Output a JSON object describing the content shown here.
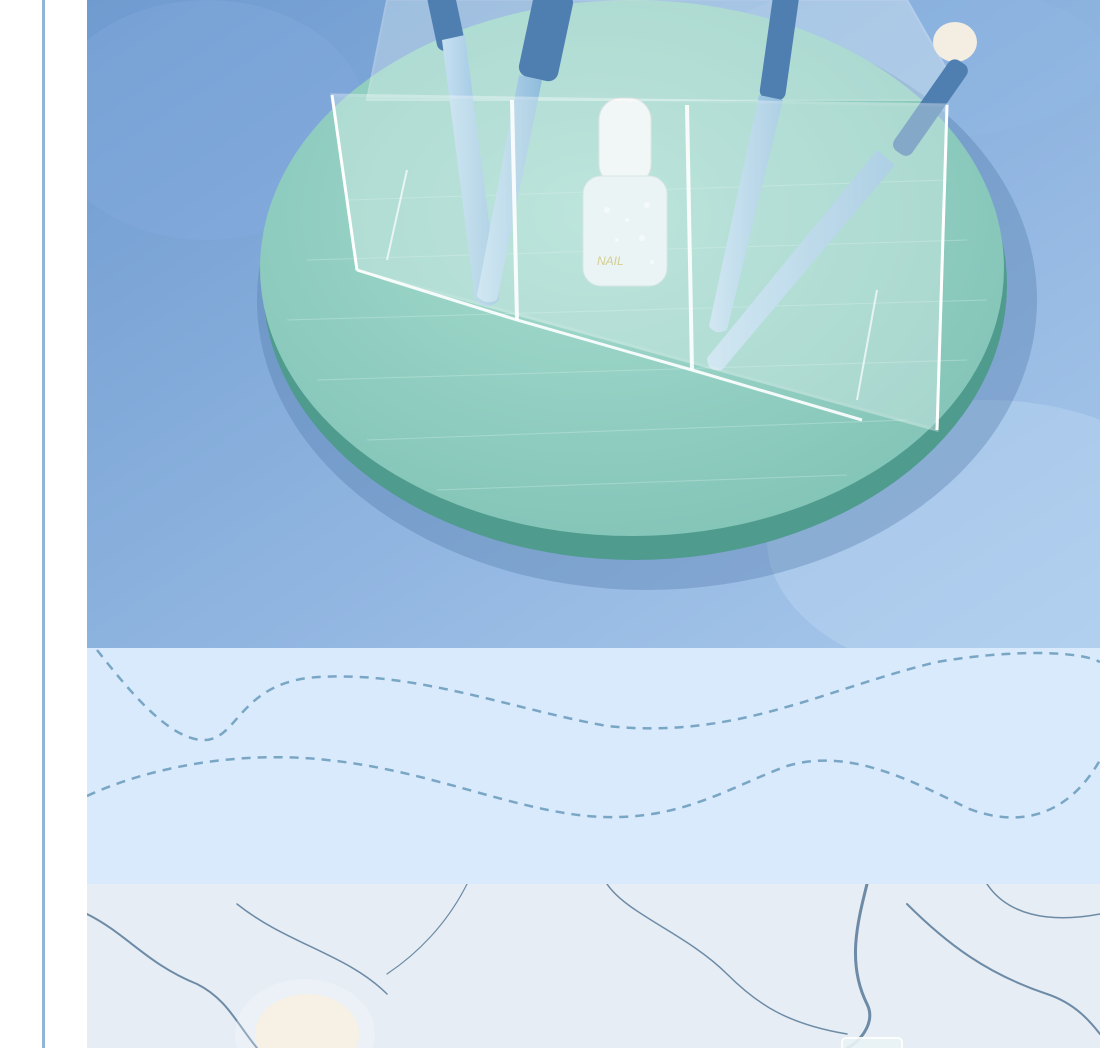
{
  "colors": {
    "rule": "#8fb4d6",
    "backdrop": "#6f9bd0",
    "backdrop_light": "#a9c9ec",
    "tray": "#7fc2b5",
    "tray_edge": "#4f9c8f",
    "acrylic": "#e8f4f4",
    "brush_handle_light": "#a9cfe8",
    "brush_handle_dark": "#4f7fb0",
    "band": "#d8eafb",
    "wave": "#7aa6c6",
    "marble": "#e6edf4",
    "marble_vein": "#6d8ba6"
  },
  "product": {
    "bottle_label": "NAIL"
  }
}
